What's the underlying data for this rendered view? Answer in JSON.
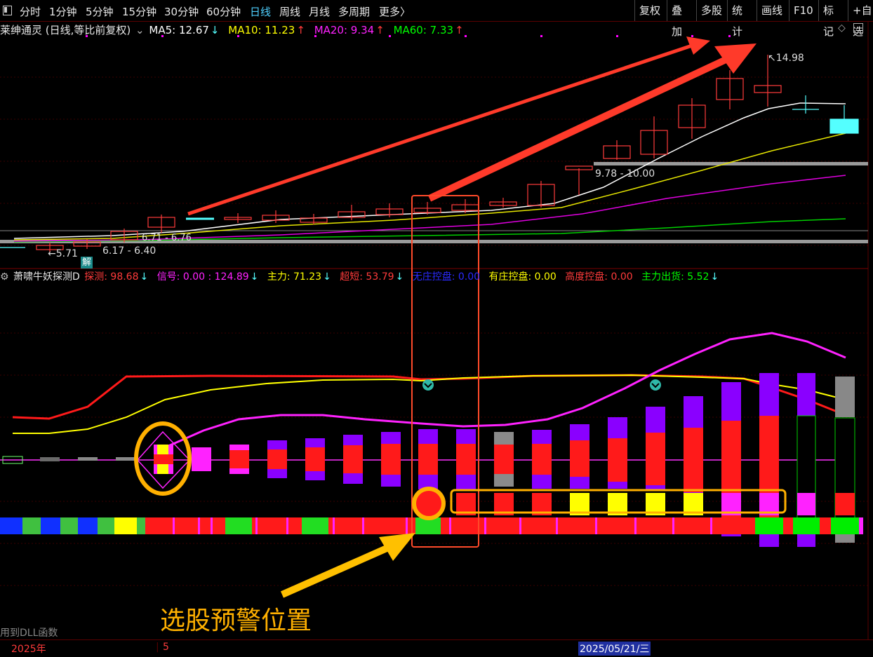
{
  "toolbar": {
    "tabs": [
      "分时",
      "1分钟",
      "5分钟",
      "15分钟",
      "30分钟",
      "60分钟",
      "日线",
      "周线",
      "月线",
      "多周期",
      "更多〉"
    ],
    "active_tab": "日线",
    "right_buttons": [
      "复权",
      "叠加",
      "多股",
      "统计",
      "画线",
      "F10",
      "标记",
      "+自选"
    ]
  },
  "main_chart": {
    "title": "莱绅通灵 (日线,等比前复权)",
    "ma5": "MA5: 12.67",
    "ma10": "MA10: 11.23",
    "ma20": "MA20: 9.34",
    "ma60": "MA60: 7.33",
    "arrow_down": "↓",
    "arrow_up": "↑",
    "high_label": "14.98",
    "low_label": "5.71",
    "range_label_1": "6.17 - 6.40",
    "range_label_2": "6.71 - 6.76",
    "range_label_3": "9.78 - 10.00",
    "jie_badge": "解",
    "colors": {
      "up": "#ff3b3b",
      "down": "#54ffff",
      "ma5": "#ffffff",
      "ma10": "#ffff00",
      "ma20": "#ff00ff",
      "ma60": "#00ff00"
    }
  },
  "indicator": {
    "name": "萧啸牛妖探测D",
    "tance": "探测: 98.68",
    "xinhao": "信号: 0.00 : 124.89",
    "zhuli": "主力: 71.23",
    "chaoduan": "超短: 53.79",
    "wuzhuang": "无庄控盘: 0.00",
    "youzhuang": "有庄控盘: 0.00",
    "gaodu": "高度控盘: 0.00",
    "chuhuo": "主力出货: 5.52"
  },
  "annotation": {
    "text": "选股预警位置"
  },
  "status": {
    "dll_note": "用到DLL函数",
    "year": "2025年",
    "month": "5",
    "date": "2025/05/21/三"
  }
}
